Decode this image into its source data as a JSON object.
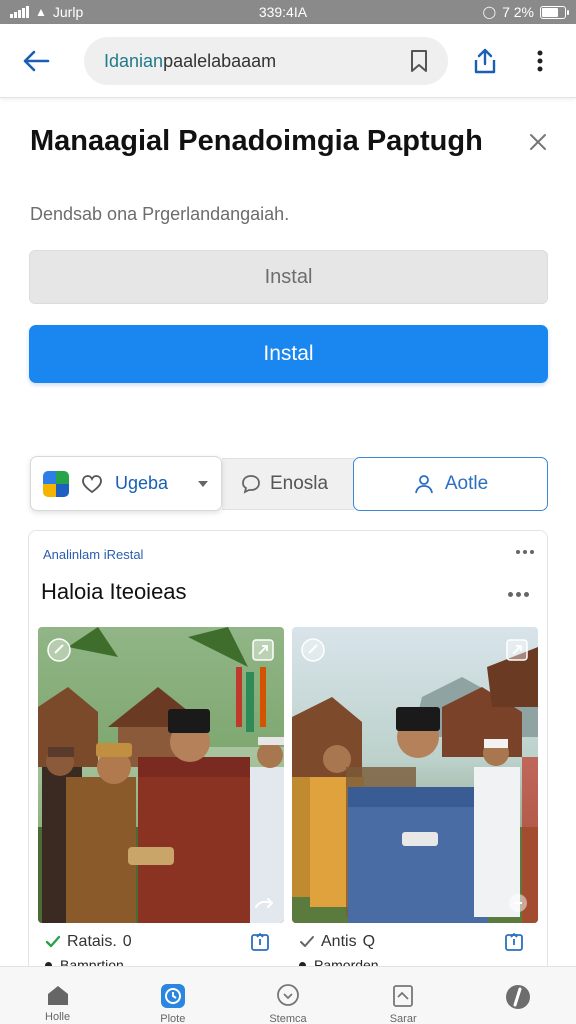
{
  "status_bar": {
    "carrier": "Jurlp",
    "time": "339:4IA",
    "battery": "7 2%",
    "battery_level": 0.72
  },
  "browser": {
    "url_domain": "Idanian",
    "url_rest": "paalelabaaam"
  },
  "prompt": {
    "title": "Manaagial Penadoimgia Paptugh",
    "subtitle": "Dendsab ona Prgerlandangaiah.",
    "secondary_button": "Instal",
    "primary_button": "Instal"
  },
  "segments": {
    "language_label": "Ugeba",
    "middle_label": "Enosla",
    "right_label": "Aotle"
  },
  "feed": {
    "tag": "Analinlam iRestal",
    "title": "Haloia Iteoieas",
    "left_meta_label": "Ratais.",
    "left_meta_count": "0",
    "left_meta_sub": "Bamprtion",
    "right_meta_label": "Antis",
    "right_meta_count": "Q",
    "right_meta_sub": "Pamorden"
  },
  "bottom_nav": {
    "items": [
      {
        "label": "Holle",
        "icon": "home-icon"
      },
      {
        "label": "Plote",
        "icon": "clock-icon"
      },
      {
        "label": "Stemca",
        "icon": "chat-icon"
      },
      {
        "label": "Sarar",
        "icon": "note-icon"
      },
      {
        "label": "",
        "icon": "compass-icon"
      }
    ]
  },
  "colors": {
    "accent": "#1a86f0",
    "link": "#2a6fc0",
    "status_bar": "#8a8a8a"
  }
}
